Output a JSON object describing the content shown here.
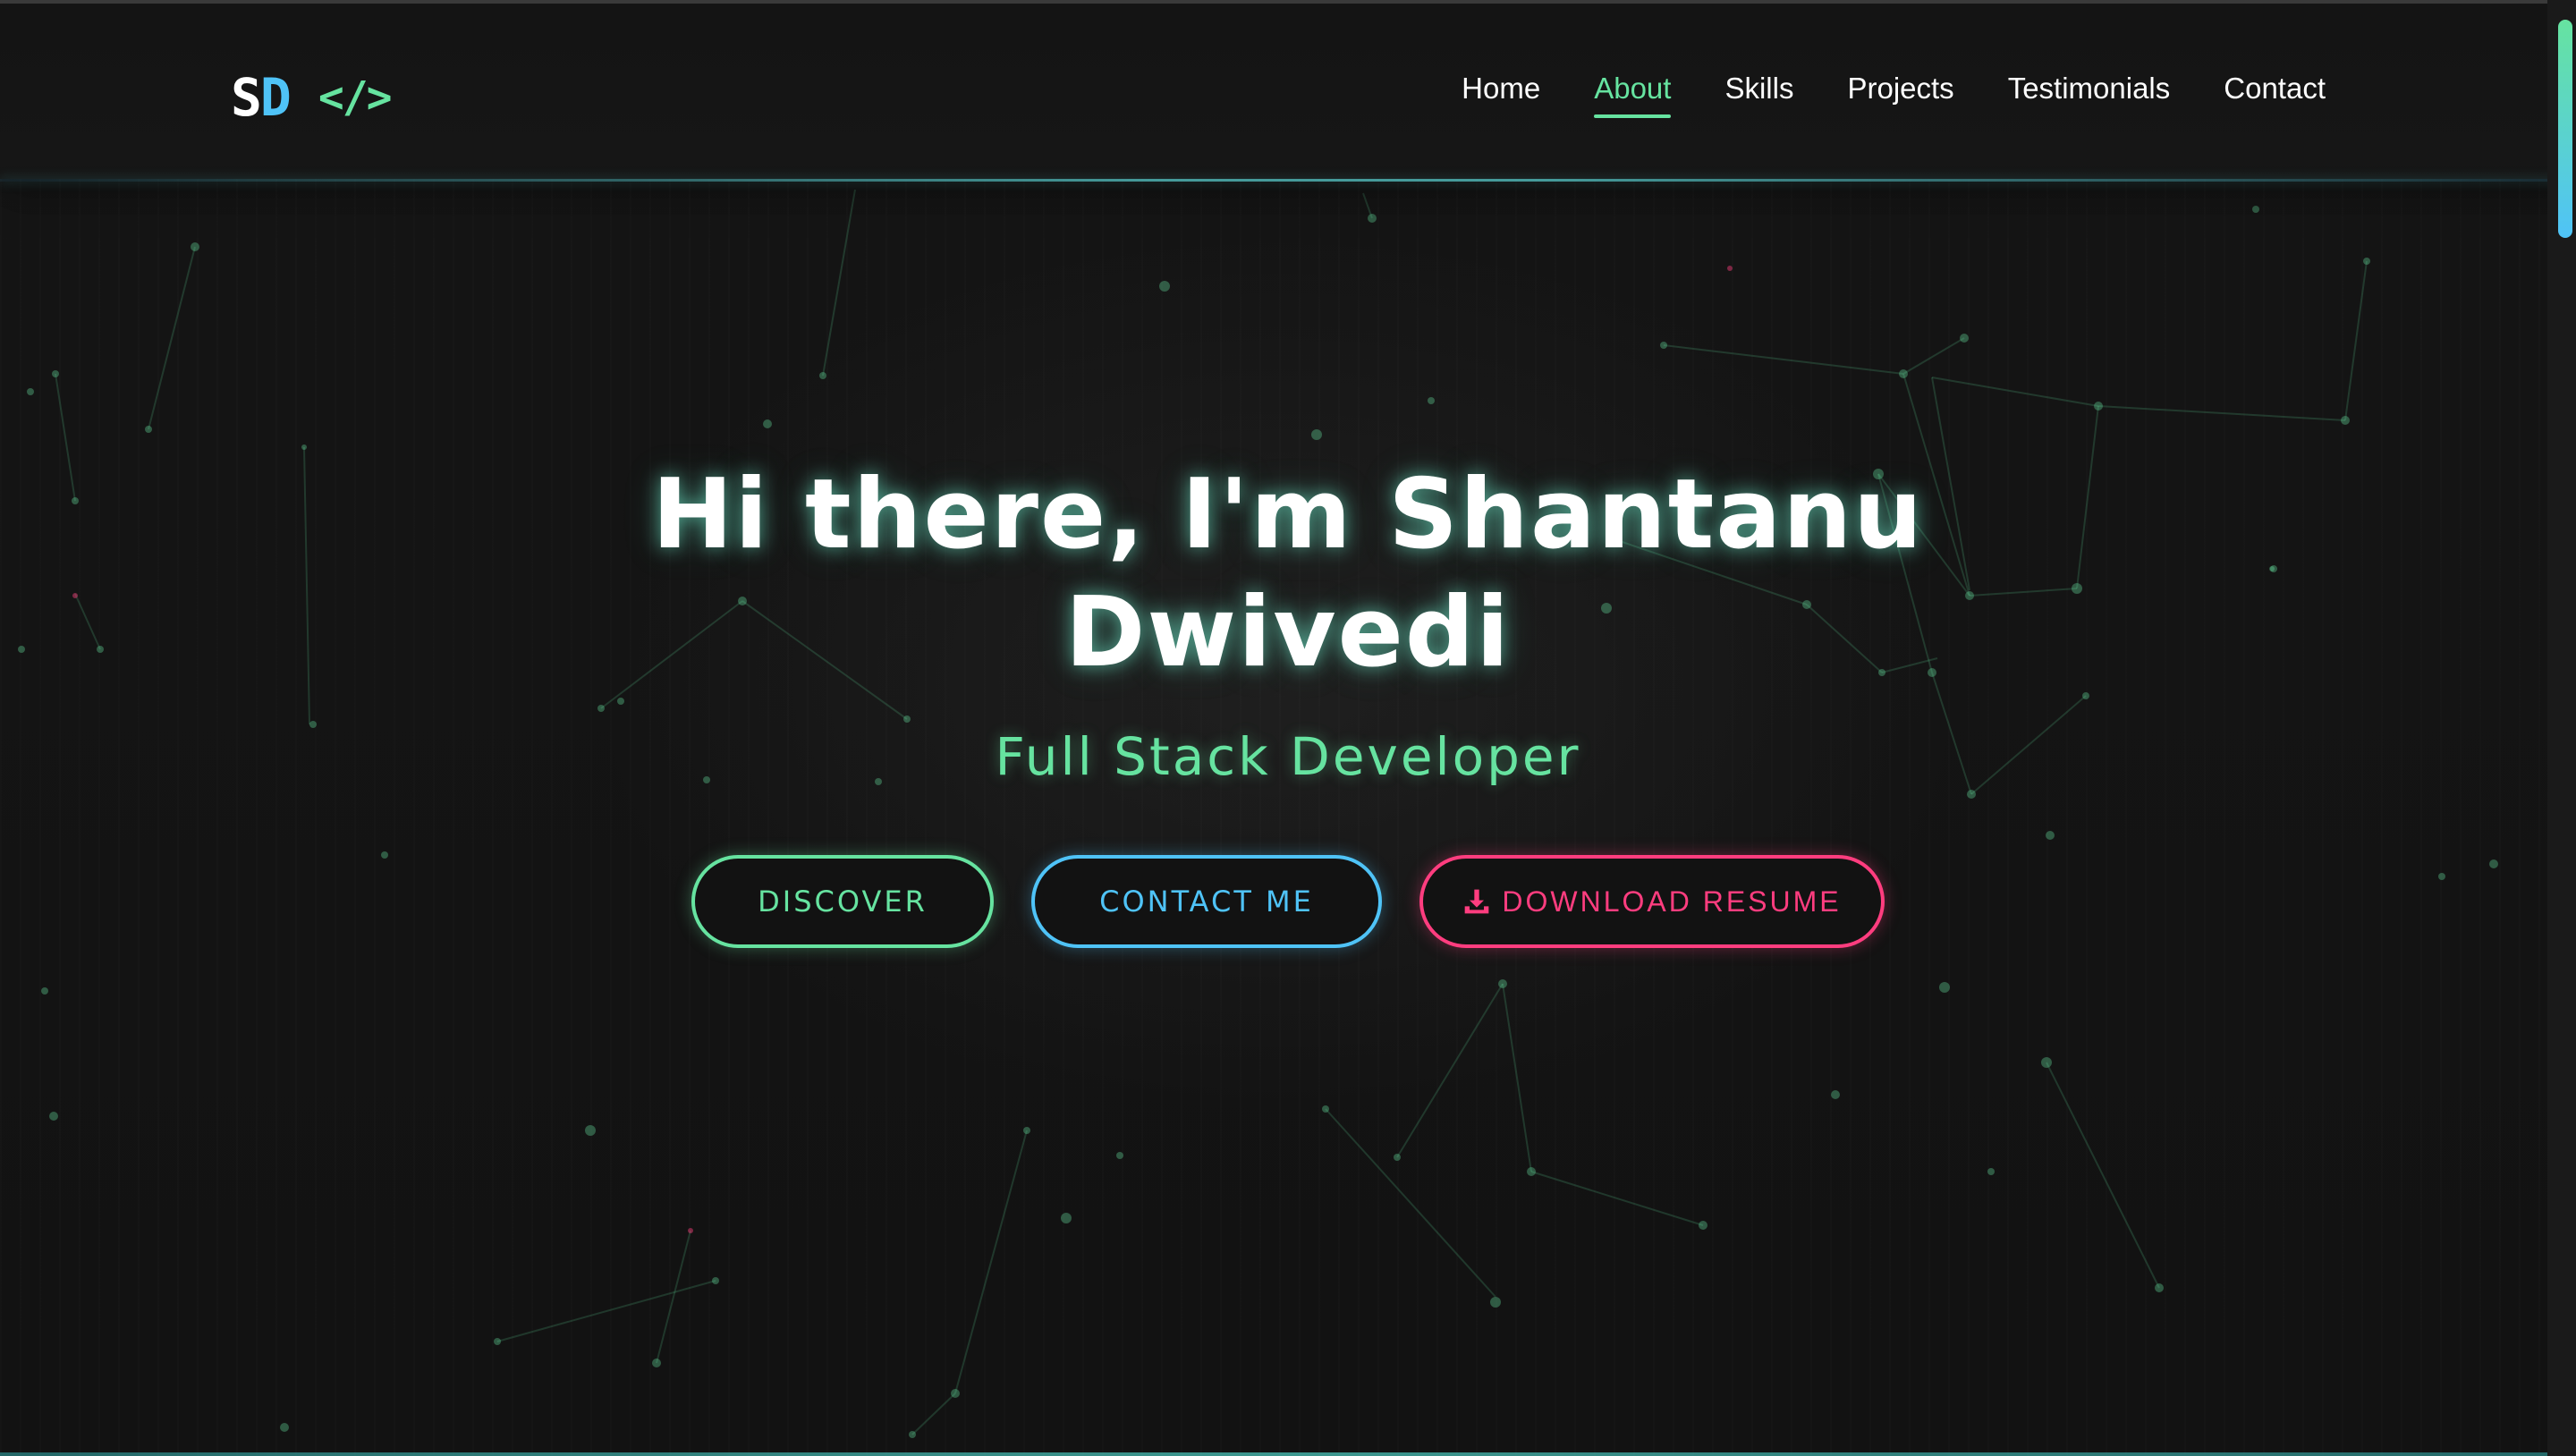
{
  "logo": {
    "initial_s": "S",
    "initial_d": "D",
    "code_symbol": "</>"
  },
  "nav": {
    "items": [
      {
        "label": "Home",
        "active": false
      },
      {
        "label": "About",
        "active": true
      },
      {
        "label": "Skills",
        "active": false
      },
      {
        "label": "Projects",
        "active": false
      },
      {
        "label": "Testimonials",
        "active": false
      },
      {
        "label": "Contact",
        "active": false
      }
    ]
  },
  "hero": {
    "title_line1": "Hi there, I'm Shantanu",
    "title_line2": "Dwivedi",
    "subtitle": "Full Stack Developer",
    "buttons": {
      "discover": "DISCOVER",
      "contact": "CONTACT ME",
      "resume": "DOWNLOAD RESUME",
      "resume_icon": "download-icon"
    }
  },
  "colors": {
    "background": "#121212",
    "accent_green": "#66e3a0",
    "accent_blue": "#4fc3f7",
    "accent_pink": "#ff3d7f"
  }
}
